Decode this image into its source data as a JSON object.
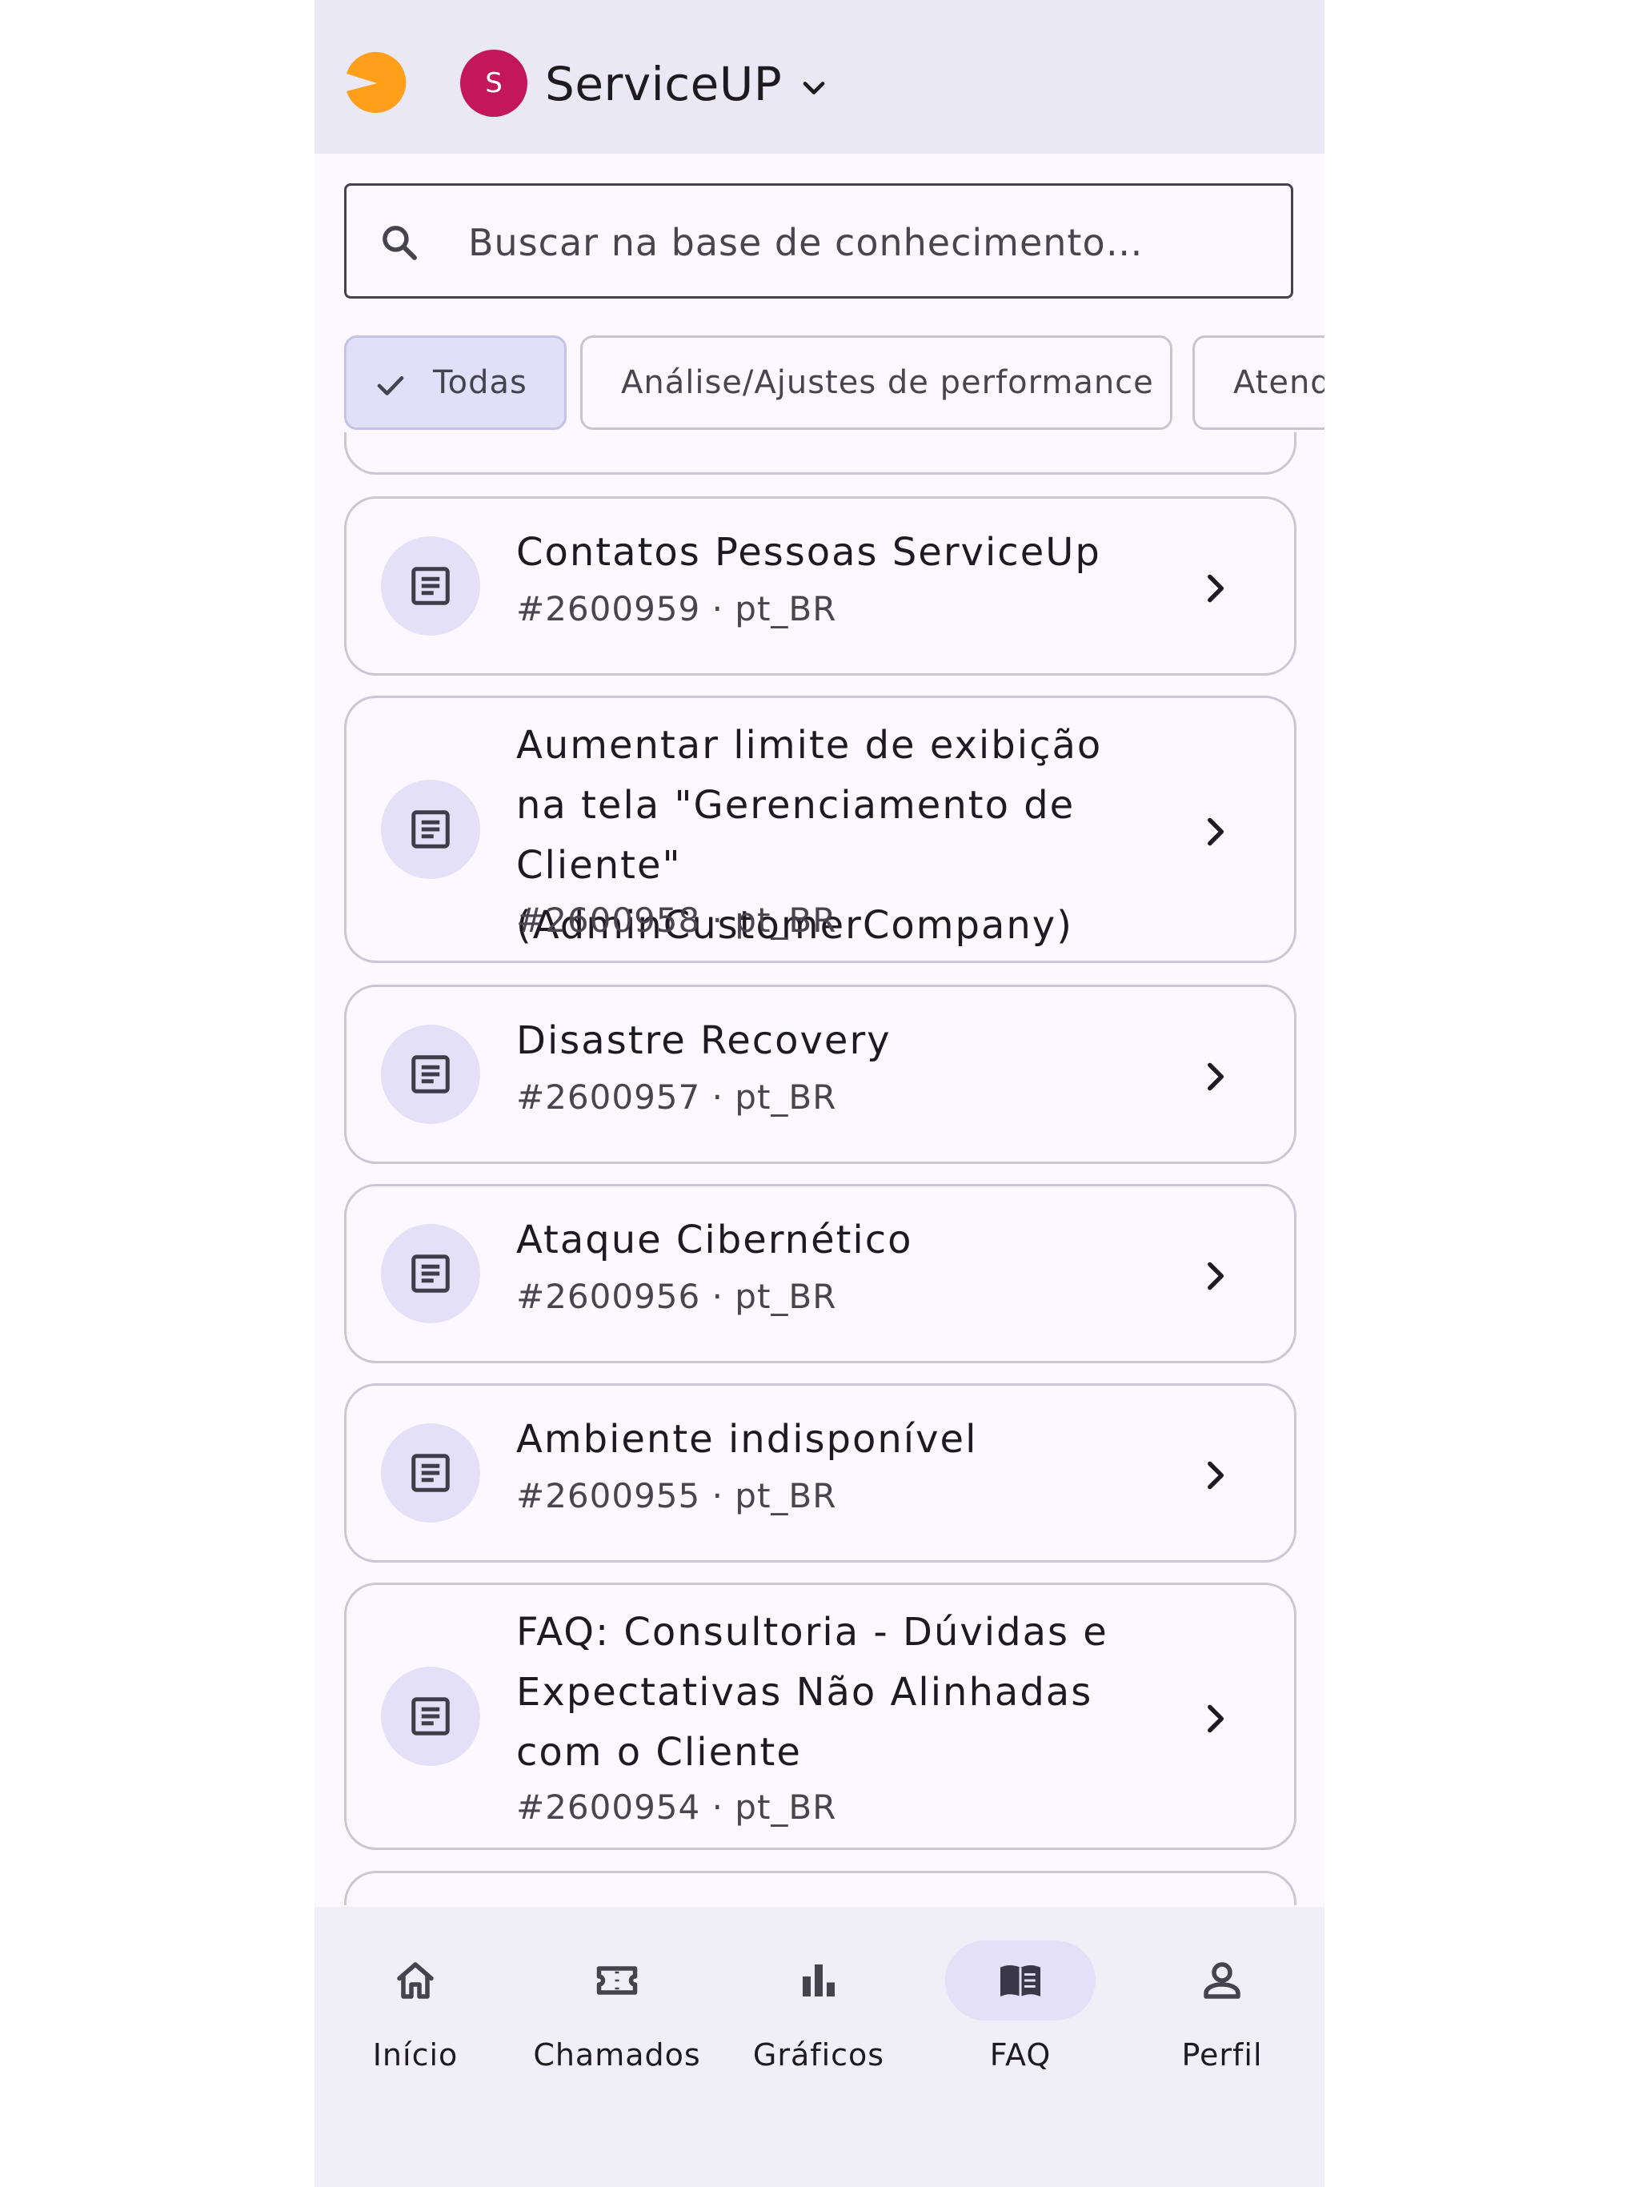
{
  "header": {
    "logo_icon": "pacman-logo-icon",
    "avatar_letter": "S",
    "title": "ServiceUP",
    "brand_color": "#ff9f1a",
    "avatar_color": "#c2185b"
  },
  "search": {
    "placeholder": "Buscar na base de conhecimento…",
    "value": ""
  },
  "chips": [
    {
      "label": "Todas",
      "selected": true
    },
    {
      "label": "Análise/Ajustes de performance",
      "selected": false
    },
    {
      "label": "Atendimento",
      "selected": false
    }
  ],
  "articles": [
    {
      "title": "Contatos Pessoas ServiceUp",
      "meta": "#2600959 · pt_BR"
    },
    {
      "title": "Aumentar limite de exibição na tela \"Gerenciamento de Cliente\" (AdminCustomerCompany)",
      "meta": "#2600958 · pt_BR"
    },
    {
      "title": "Disastre Recovery",
      "meta": "#2600957 · pt_BR"
    },
    {
      "title": "Ataque Cibernético",
      "meta": "#2600956 · pt_BR"
    },
    {
      "title": "Ambiente indisponível",
      "meta": "#2600955 · pt_BR"
    },
    {
      "title": "FAQ: Consultoria - Dúvidas e Expectativas Não Alinhadas com o Cliente",
      "meta": "#2600954 · pt_BR"
    }
  ],
  "nav": [
    {
      "label": "Início",
      "icon": "home-icon",
      "active": false
    },
    {
      "label": "Chamados",
      "icon": "ticket-icon",
      "active": false
    },
    {
      "label": "Gráficos",
      "icon": "bar-chart-icon",
      "active": false
    },
    {
      "label": "FAQ",
      "icon": "book-icon",
      "active": true
    },
    {
      "label": "Perfil",
      "icon": "person-icon",
      "active": false
    }
  ]
}
